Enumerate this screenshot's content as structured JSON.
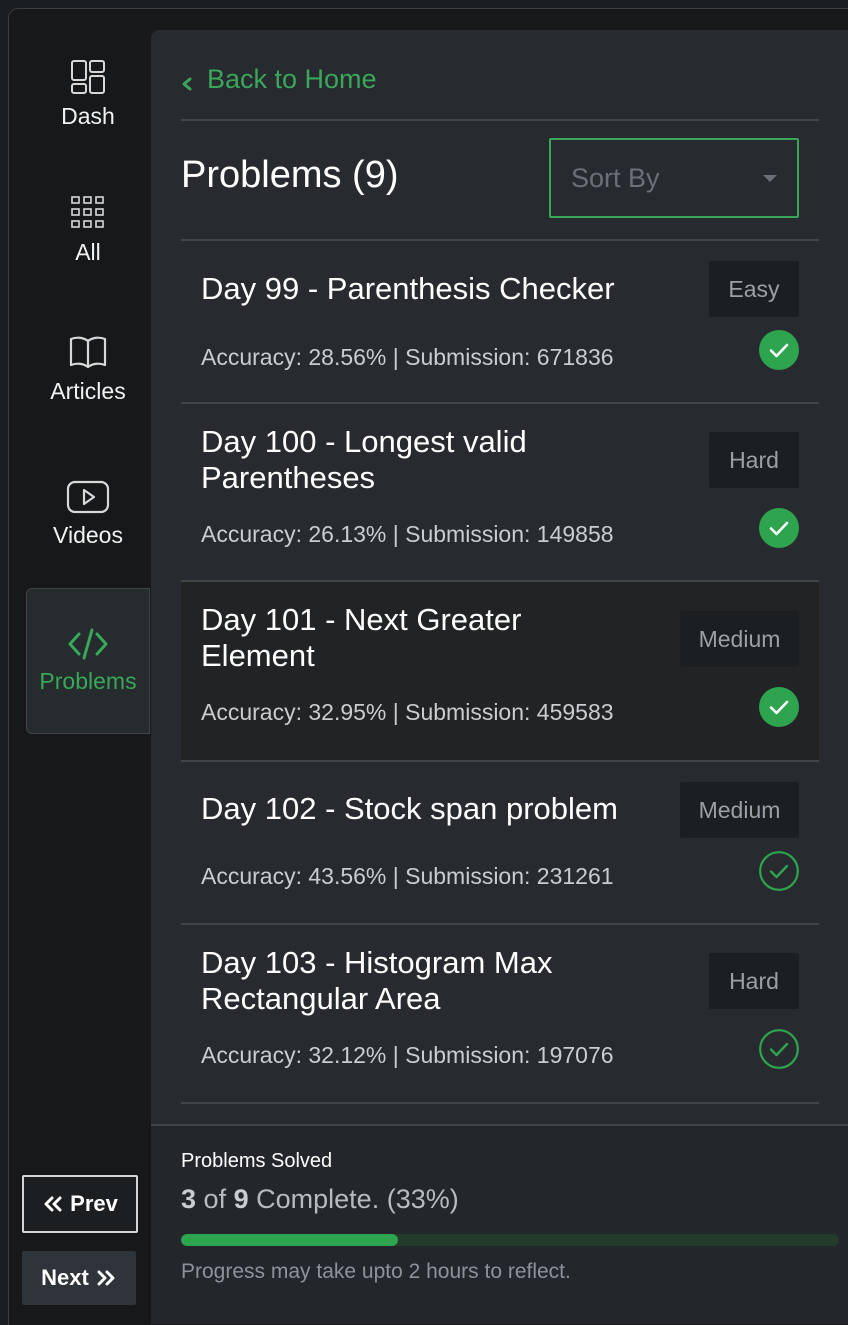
{
  "sidebar": {
    "items": [
      {
        "label": "Dash",
        "icon": "dashboard-icon"
      },
      {
        "label": "All",
        "icon": "grid-icon"
      },
      {
        "label": "Articles",
        "icon": "book-icon"
      },
      {
        "label": "Videos",
        "icon": "play-icon"
      },
      {
        "label": "Problems",
        "icon": "code-icon",
        "active": true
      }
    ],
    "prev_label": "Prev",
    "next_label": "Next"
  },
  "header": {
    "back_label": "Back to Home",
    "title": "Problems (9)",
    "sort_placeholder": "Sort By"
  },
  "problems": [
    {
      "title": "Day 99 - Parenthesis Checker",
      "meta": "Accuracy: 28.56% | Submission: 671836",
      "difficulty": "Easy",
      "status": "solved"
    },
    {
      "title": "Day 100 - Longest valid Parentheses",
      "meta": "Accuracy: 26.13% | Submission: 149858",
      "difficulty": "Hard",
      "status": "solved"
    },
    {
      "title": "Day 101 - Next Greater Element",
      "meta": "Accuracy: 32.95% | Submission: 459583",
      "difficulty": "Medium",
      "status": "solved"
    },
    {
      "title": "Day 102 - Stock span problem",
      "meta": "Accuracy: 43.56% | Submission: 231261",
      "difficulty": "Medium",
      "status": "unsolved"
    },
    {
      "title": "Day 103 - Histogram Max Rectangular Area",
      "meta": "Accuracy: 32.12% | Submission: 197076",
      "difficulty": "Hard",
      "status": "unsolved"
    }
  ],
  "progress": {
    "label": "Problems Solved",
    "solved": "3",
    "of_word": "of",
    "total": "9",
    "suffix": "Complete. (33%)",
    "fraction": 0.33,
    "note": "Progress may take upto 2 hours to reflect."
  },
  "colors": {
    "accent": "#3aa65a",
    "panel": "#272b2f",
    "sidebar": "#161819"
  }
}
